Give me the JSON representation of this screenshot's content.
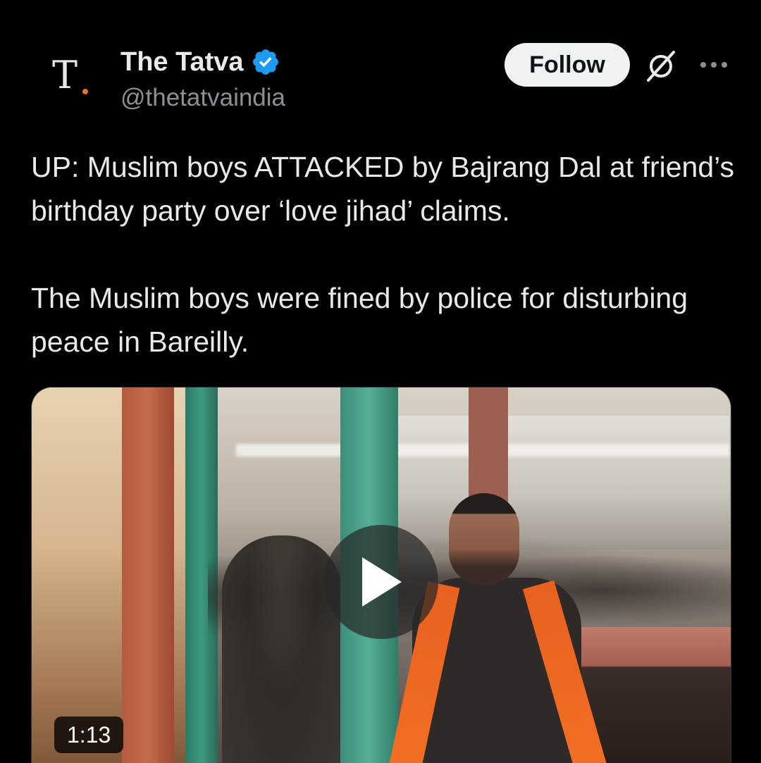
{
  "author": {
    "display_name": "The Tatva",
    "handle": "@thetatvaindia",
    "verified": true,
    "avatar_logo_text": "T"
  },
  "actions": {
    "follow_label": "Follow",
    "grok_icon": "grok-icon",
    "more_icon": "more-options-icon"
  },
  "tweet": {
    "paragraphs": [
      "UP: Muslim boys ATTACKED by Bajrang Dal at friend’s birthday party over ‘love jihad’ claims.",
      "The Muslim boys were fined by police for disturbing peace in Bareilly."
    ]
  },
  "media": {
    "type": "video",
    "duration": "1:13",
    "play_icon": "play-icon"
  },
  "colors": {
    "background": "#000000",
    "text_primary": "#e7e9ea",
    "text_secondary": "#8b9096",
    "verified_blue": "#1d9bf0",
    "follow_bg": "#eff3f4"
  }
}
